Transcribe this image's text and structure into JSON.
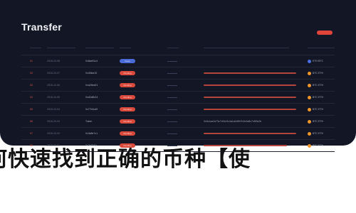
{
  "window": {
    "title": "Transfer"
  },
  "toolbar": {
    "action_label": ""
  },
  "rows": [
    {
      "idx": "01",
      "date": "2018-10-08",
      "name": "0x8ae51c4",
      "pill": "Done",
      "pill_blue": true,
      "detail": "",
      "bar_pct": 0,
      "coin": "ETH BTC",
      "coin_blue": true
    },
    {
      "idx": "02",
      "date": "2018-10-07",
      "name": "0x45fae32",
      "pill": "Pending",
      "pill_blue": false,
      "detail": "",
      "bar_pct": 100,
      "coin": "BTC ETH",
      "coin_blue": false
    },
    {
      "idx": "03",
      "date": "2018-10-06",
      "name": "0xa25ea01",
      "pill": "Pending",
      "pill_blue": false,
      "detail": "",
      "bar_pct": 100,
      "coin": "BTC ETH",
      "coin_blue": false
    },
    {
      "idx": "04",
      "date": "2018-10-05",
      "name": "0xd2a8b24",
      "pill": "Pending",
      "pill_blue": false,
      "detail": "",
      "bar_pct": 100,
      "coin": "BTC ETH",
      "coin_blue": false
    },
    {
      "idx": "05",
      "date": "2018-10-04",
      "name": "0x77b3cd9",
      "pill": "Pending",
      "pill_blue": false,
      "detail": "",
      "bar_pct": 100,
      "coin": "BTC ETH",
      "coin_blue": false
    },
    {
      "idx": "06",
      "date": "2018-10-03",
      "name": "Token",
      "pill": "Pending",
      "pill_blue": false,
      "detail": "0x0c1aa2a73c7c51e3c4a1a0d9b7b2e4a8c7c8f0c2b",
      "bar_pct": 90,
      "coin": "BTC ETH",
      "coin_blue": false
    },
    {
      "idx": "07",
      "date": "2018-10-02",
      "name": "0x3a8e7c1",
      "pill": "Pending",
      "pill_blue": false,
      "detail": "",
      "bar_pct": 100,
      "coin": "BTC ETH",
      "coin_blue": false
    },
    {
      "idx": "08",
      "date": "2018-10-01",
      "name": "0x2e91f6a",
      "pill": "Pending",
      "pill_blue": false,
      "detail": "",
      "bar_pct": 90,
      "coin": "BTC ETH",
      "coin_blue": false
    }
  ],
  "caption": "何快速找到正确的币种【使"
}
